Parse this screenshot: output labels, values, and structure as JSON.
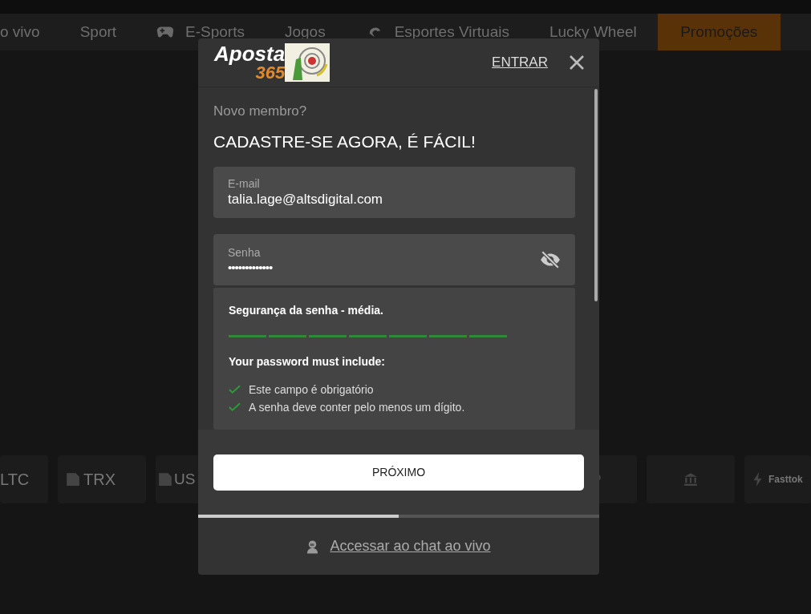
{
  "nav": [
    {
      "label": "o vivo",
      "selected": false
    },
    {
      "label": "Sport",
      "selected": false
    },
    {
      "label": "E-Sports",
      "selected": false
    },
    {
      "label": "Jogos",
      "selected": false
    },
    {
      "label": "Esportes Virtuais",
      "selected": false
    },
    {
      "label": "Lucky Wheel",
      "selected": false
    },
    {
      "label": "Promoções",
      "selected": true
    }
  ],
  "payment_tiles": [
    {
      "label": "LTC",
      "kind": "text"
    },
    {
      "label": "TRX",
      "kind": "broken"
    },
    {
      "label": "US",
      "kind": "broken"
    },
    {
      "kind": "logo"
    },
    {
      "kind": "bank"
    },
    {
      "label": "Fasttok",
      "kind": "bolt"
    }
  ],
  "modal": {
    "logo": {
      "word": "Aposta",
      "number": "365"
    },
    "login_link": "ENTRAR",
    "subtitle": "Novo membro?",
    "title": "CADASTRE-SE AGORA, É FÁCIL!",
    "email": {
      "label": "E-mail",
      "value": "talia.lage@altsdigital.com"
    },
    "password": {
      "label": "Senha",
      "value": "•••••••••••••"
    },
    "strength": {
      "title": "Segurança da senha - média.",
      "segments": [
        {
          "filled": true
        },
        {
          "filled": true
        },
        {
          "filled": true
        },
        {
          "filled": true
        },
        {
          "filled": true
        },
        {
          "filled": true
        },
        {
          "filled": true
        }
      ]
    },
    "requirements_title": "Your password must include:",
    "requirements": [
      {
        "text": "Este campo é obrigatório",
        "checked": true
      },
      {
        "text": "A senha deve conter pelo menos um dígito.",
        "checked": true
      }
    ],
    "next_button": "PRÓXIMO",
    "progress": {
      "level": 0.5
    },
    "chat_link": "Accessar ao chat ao vivo"
  }
}
